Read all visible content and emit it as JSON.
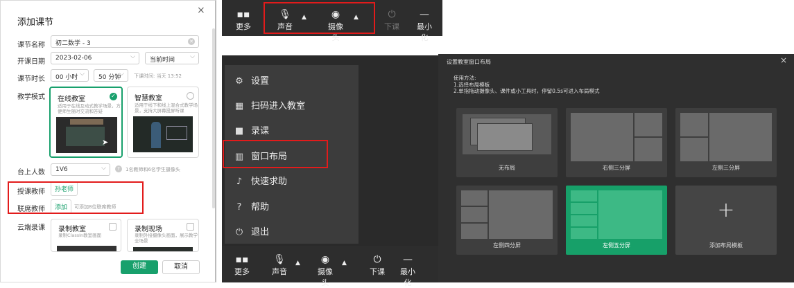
{
  "dialog": {
    "title": "添加课节",
    "close": "×",
    "lesson_name_label": "课节名称",
    "lesson_name_value": "初二数学 - 3",
    "date_label": "开课日期",
    "date_value": "2023-02-06",
    "time_value": "当前时间",
    "duration_label": "课节时长",
    "hours_value": "00 小时",
    "minutes_value": "50 分钟",
    "end_hint": "下课时间: 当天 13:52",
    "mode_label": "教学模式",
    "mode_online_title": "在线教室",
    "mode_online_desc": "适用于在线互动式教学场景，方便师生随时交流和答疑",
    "mode_smart_title": "智慧教室",
    "mode_smart_desc": "适用于线下和线上混合式教学场景，支持大屏幕投屏听课",
    "stage_label": "台上人数",
    "stage_value": "1V6",
    "stage_hint": "1名教师和6名学生摄像头",
    "teacher_label": "授课教师",
    "teacher_value": "孙老师",
    "coteacher_label": "联席教师",
    "coteacher_add": "添加",
    "coteacher_hint": "可添加8位联席教师",
    "record_label": "云端录课",
    "rec_class_title": "录制教室",
    "rec_class_desc": "录制ClassIn教室画面",
    "rec_live_title": "录制现场",
    "rec_live_desc": "录制外接摄像头画面，展示教学全场景",
    "create_btn": "创建",
    "cancel_btn": "取消"
  },
  "toolbar_top": {
    "more": "更多",
    "audio": "声音",
    "camera": "摄像头",
    "end_class": "下课",
    "minimize": "最小化"
  },
  "menu": {
    "items": [
      "设置",
      "扫码进入教室",
      "录课",
      "窗口布局",
      "快速求助",
      "帮助",
      "退出"
    ]
  },
  "toolbar_bottom": {
    "more": "更多",
    "audio": "声音",
    "camera": "摄像头",
    "end_class": "下课",
    "minimize": "最小化"
  },
  "layout_dialog": {
    "title": "设置教室窗口布局",
    "close": "×",
    "instructions": [
      "使用方法:",
      "1.选择布局模板",
      "2.单指拖动摄像头、课件或小工具时，停留0.5s可进入布局模式"
    ],
    "tiles": [
      "无布局",
      "右侧三分屏",
      "左侧三分屏",
      "左侧四分屏",
      "左侧五分屏",
      "添加布局模板"
    ],
    "selected": "左侧五分屏"
  },
  "colors": {
    "accent": "#18a06c",
    "highlight": "#e21b1b",
    "panel": "#2d2d2d"
  }
}
